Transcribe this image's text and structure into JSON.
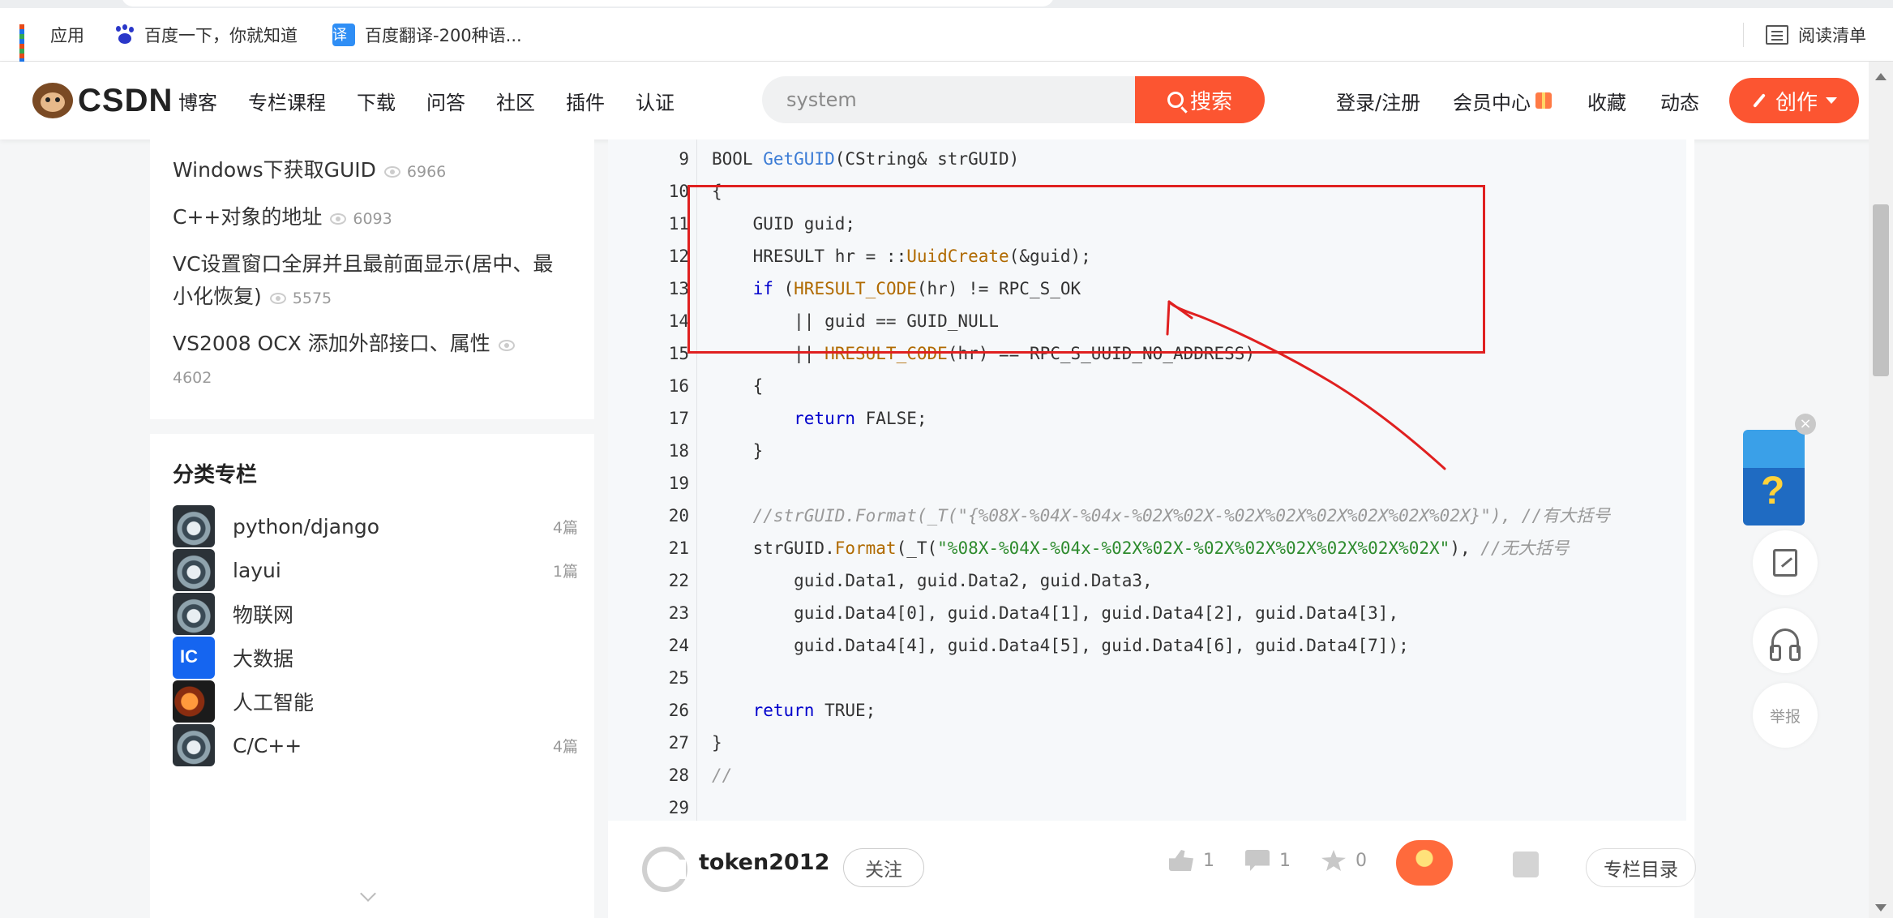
{
  "bookmarks": {
    "apps_label": "应用",
    "baidu_label": "百度一下，你就知道",
    "fanyi_icon_char": "译",
    "fanyi_label": "百度翻译-200种语...",
    "reading_list_label": "阅读清单"
  },
  "header": {
    "logo_text": "CSDN",
    "nav": [
      "博客",
      "专栏课程",
      "下载",
      "问答",
      "社区",
      "插件",
      "认证"
    ],
    "search_value": "system",
    "search_button": "搜索",
    "login": "登录/注册",
    "vip": "会员中心",
    "favorites": "收藏",
    "dynamics": "动态",
    "create": "创作",
    "accent_color": "#fc5531"
  },
  "hot_articles": [
    {
      "title": "Windows下获取GUID",
      "views": "6966"
    },
    {
      "title": "C++对象的地址",
      "views": "6093"
    },
    {
      "title_line1": "VC设置窗口全屏并且最前面显示(居中、最",
      "title_line2": "小化恢复)",
      "views": "5575"
    },
    {
      "title": "VS2008 OCX 添加外部接口、属性",
      "views": "4602"
    }
  ],
  "columns": {
    "title": "分类专栏",
    "items": [
      {
        "name": "python/django",
        "count": "4篇",
        "icon": "eye-thumbnail"
      },
      {
        "name": "layui",
        "count": "1篇",
        "icon": "eye-thumbnail"
      },
      {
        "name": "物联网",
        "count": "",
        "icon": "eye-thumbnail"
      },
      {
        "name": "大数据",
        "count": "",
        "icon": "bigdata-thumbnail"
      },
      {
        "name": "人工智能",
        "count": "",
        "icon": "ai-thumbnail"
      },
      {
        "name": "C/C++",
        "count": "4篇",
        "icon": "eye-thumbnail"
      }
    ]
  },
  "code": {
    "line_numbers": [
      "9",
      "10",
      "11",
      "12",
      "13",
      "14",
      "15",
      "16",
      "17",
      "18",
      "19",
      "20",
      "21",
      "22",
      "23",
      "24",
      "25",
      "26",
      "27",
      "28",
      "29"
    ],
    "l9_a": "BOOL ",
    "l9_fn": "GetGUID",
    "l9_b": "(CString& strGUID)",
    "l10": "{",
    "l11": "    GUID guid;",
    "l12_a": "    HRESULT hr = ::",
    "l12_fn": "UuidCreate",
    "l12_b": "(&guid);",
    "l13_kw": "    if",
    "l13_a": " (",
    "l13_mac": "HRESULT_CODE",
    "l13_b": "(hr) != RPC_S_OK",
    "l14": "        || guid == GUID_NULL",
    "l15_a": "        || ",
    "l15_mac": "HRESULT_CODE",
    "l15_b": "(hr) == RPC_S_UUID_NO_ADDRESS)",
    "l16": "    {",
    "l17_kw": "        return",
    "l17_b": " FALSE;",
    "l18": "    }",
    "l19": "",
    "l20": "    //strGUID.Format(_T(\"{%08X-%04X-%04x-%02X%02X-%02X%02X%02X%02X%02X%02X}\"), //有大括号",
    "l21_a": "    strGUID.",
    "l21_fn": "Format",
    "l21_b": "(_T(",
    "l21_str": "\"%08X-%04X-%04x-%02X%02X-%02X%02X%02X%02X%02X%02X\"",
    "l21_c": "), ",
    "l21_cm": "//无大括号",
    "l22": "        guid.Data1, guid.Data2, guid.Data3,",
    "l23": "        guid.Data4[0], guid.Data4[1], guid.Data4[2], guid.Data4[3],",
    "l24": "        guid.Data4[4], guid.Data4[5], guid.Data4[6], guid.Data4[7]);",
    "l25": "",
    "l26_kw": "    return",
    "l26_b": " TRUE;",
    "l27": "}",
    "l28": "//",
    "l29": ""
  },
  "toolbar": {
    "author": "token2012",
    "follow": "关注",
    "likes": "1",
    "comments": "1",
    "stars": "0",
    "toc": "专栏目录"
  },
  "right_tools": {
    "close": "×",
    "report": "举报"
  }
}
